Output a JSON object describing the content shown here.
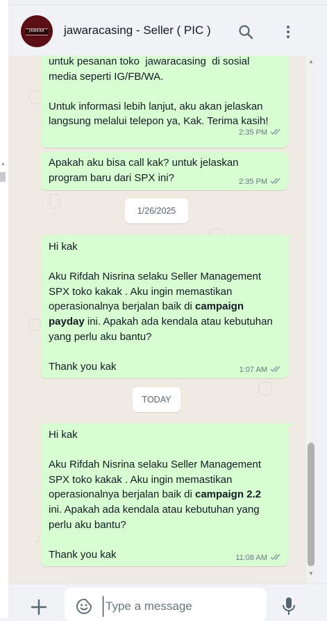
{
  "header": {
    "contact_name": "jawaracasing - Seller ( PIC )",
    "avatar_text": "JAWARA",
    "search_icon": "search-icon",
    "menu_icon": "kebab-menu-icon"
  },
  "messages": [
    {
      "text": "untuk pesanan toko  jawaracasing  di sosial\nmedia seperti IG/FB/WA.\n\nUntuk informasi lebih lanjut, aku akan jelaskan\nlangsung melalui telepon ya, Kak. Terima kasih!",
      "time": "2:35 PM"
    },
    {
      "text": "Apakah aku bisa call kak? untuk jelaskan\nprogram baru dari SPX ini?",
      "time": "2:35 PM"
    },
    {
      "line1": "Hi kak",
      "line2": "Aku Rifdah Nisrina selaku Seller Management",
      "line3": "SPX toko kakak . Aku ingin memastikan",
      "line4_pre": "operasionalnya berjalan baik di ",
      "line4_bold": "campaign",
      "line5_bold": "payday",
      "line5_post": " ini. Apakah ada kendala atau kebutuhan",
      "line6": "yang perlu aku bantu?",
      "line7": "Thank you kak",
      "time": "1:07 AM"
    },
    {
      "line1": "Hi kak",
      "line2": "Aku Rifdah Nisrina selaku Seller Management",
      "line3": "SPX toko kakak . Aku ingin memastikan",
      "line4_pre": "operasionalnya berjalan baik di ",
      "line4_bold": "campaign 2.2",
      "line5": "ini. Apakah ada kendala atau kebutuhan yang",
      "line6": "perlu aku bantu?",
      "line7": "Thank you kak",
      "time": "11:08 AM"
    }
  ],
  "date_chips": [
    "1/26/2025",
    "TODAY"
  ],
  "composer": {
    "placeholder": "Type a message",
    "plus_icon": "plus-icon",
    "emoji_icon": "emoji-icon",
    "mic_icon": "microphone-icon"
  },
  "colors": {
    "outgoing_bubble": "#d9fdd3",
    "chat_background": "#efeae2",
    "read_ticks": "#8696a0"
  }
}
